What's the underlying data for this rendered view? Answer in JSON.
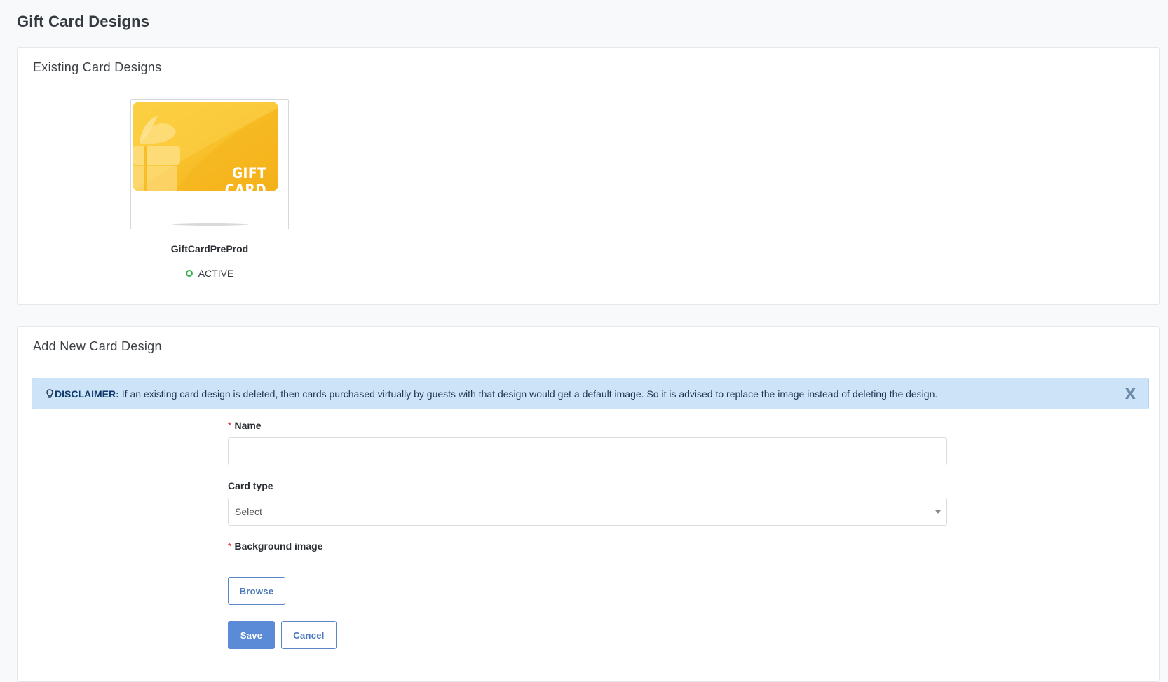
{
  "page": {
    "title": "Gift Card Designs"
  },
  "existing": {
    "heading": "Existing Card Designs",
    "cards": [
      {
        "image_text": "GIFT CARD",
        "name": "GiftCardPreProd",
        "status": "ACTIVE"
      }
    ]
  },
  "add_new": {
    "heading": "Add New Card Design",
    "disclaimer": {
      "label": "DISCLAIMER:",
      "text": "If an existing card design is deleted, then cards purchased virtually by guests with that design would get a default image. So it is advised to replace the image instead of deleting the design.",
      "close": "X"
    },
    "form": {
      "name_label": "Name",
      "name_value": "",
      "card_type_label": "Card type",
      "card_type_value": "Select",
      "background_label": "Background image",
      "required_mark": "*",
      "browse_label": "Browse",
      "save_label": "Save",
      "cancel_label": "Cancel"
    }
  },
  "colors": {
    "card_yellow": "#f7bd22",
    "status_active": "#2eb14a",
    "primary": "#5b8bd6",
    "disclaimer_bg": "#cce3f8"
  }
}
